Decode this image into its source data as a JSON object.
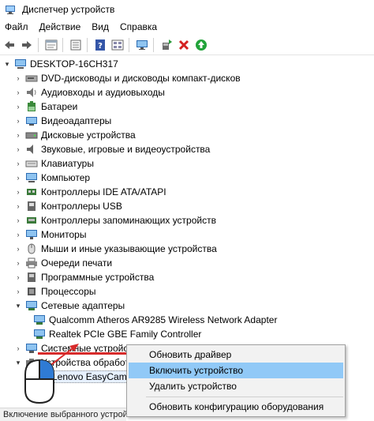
{
  "window": {
    "title": "Диспетчер устройств"
  },
  "menu": [
    "Файл",
    "Действие",
    "Вид",
    "Справка"
  ],
  "toolbar_icons": [
    "back-arrow-icon",
    "forward-arrow-icon",
    "properties-icon",
    "list-view-icon",
    "help-icon",
    "monitor-icon",
    "update-driver-icon",
    "uninstall-x-icon",
    "enable-device-icon"
  ],
  "tree": {
    "root": "DESKTOP-16CH317",
    "categories": [
      "DVD-дисководы и дисководы компакт-дисков",
      "Аудиовходы и аудиовыходы",
      "Батареи",
      "Видеоадаптеры",
      "Дисковые устройства",
      "Звуковые, игровые и видеоустройства",
      "Клавиатуры",
      "Компьютер",
      "Контроллеры IDE ATA/ATAPI",
      "Контроллеры USB",
      "Контроллеры запоминающих устройств",
      "Мониторы",
      "Мыши и иные указывающие устройства",
      "Очереди печати",
      "Программные устройства",
      "Процессоры",
      "Сетевые адаптеры"
    ],
    "network_children": [
      "Qualcomm Atheros AR9285 Wireless Network Adapter",
      "Realtek PCIe GBE Family Controller"
    ],
    "after_network": "Системные устройства",
    "imaging": "Устройства обработки изображений",
    "imaging_child": "Lenovo EasyCamera"
  },
  "context_menu": {
    "items": [
      "Обновить драйвер",
      "Включить устройство",
      "Удалить устройство",
      "Обновить конфигурацию оборудования"
    ],
    "highlighted_index": 1
  },
  "status": "Включение выбранного устройст"
}
